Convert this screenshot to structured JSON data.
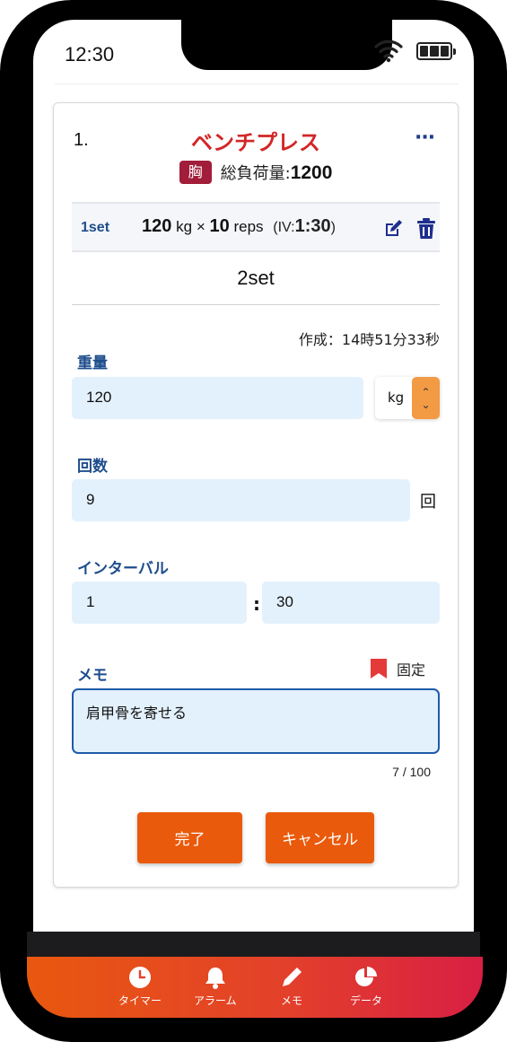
{
  "status_bar": {
    "time": "12:30"
  },
  "exercise": {
    "number": "1.",
    "name": "ベンチプレス",
    "muscle": "胸",
    "total_load_label": "総負荷量:",
    "total_load_value": "1200"
  },
  "completed_sets": [
    {
      "label": "1set",
      "weight": "120",
      "weight_unit": "kg",
      "times_sign": "×",
      "reps": "10",
      "reps_unit": "reps",
      "iv_prefix": "(IV:",
      "iv_value": "1:30",
      "iv_suffix": ")"
    }
  ],
  "current_set": {
    "title": "2set",
    "created": "作成：14時51分33秒",
    "weight_label": "重量",
    "weight_value": "120",
    "weight_unit": "kg",
    "reps_label": "回数",
    "reps_value": "9",
    "reps_unit": "回",
    "interval_label": "インターバル",
    "interval_minutes": "1",
    "interval_separator": ":",
    "interval_seconds": "30",
    "memo_label": "メモ",
    "pin_label": "固定",
    "memo_value": "肩甲骨を寄せる",
    "memo_count": "7 / 100"
  },
  "buttons": {
    "done": "完了",
    "cancel": "キャンセル"
  },
  "tabs": [
    {
      "label": "タイマー",
      "icon": "clock-icon"
    },
    {
      "label": "アラーム",
      "icon": "bell-icon"
    },
    {
      "label": "メモ",
      "icon": "pen-icon"
    },
    {
      "label": "データ",
      "icon": "pie-chart-icon"
    }
  ],
  "colors": {
    "accent_orange": "#ea5a0c",
    "title_red": "#d32626",
    "label_blue": "#1e4d8c",
    "input_bg": "#e3f1fd"
  }
}
